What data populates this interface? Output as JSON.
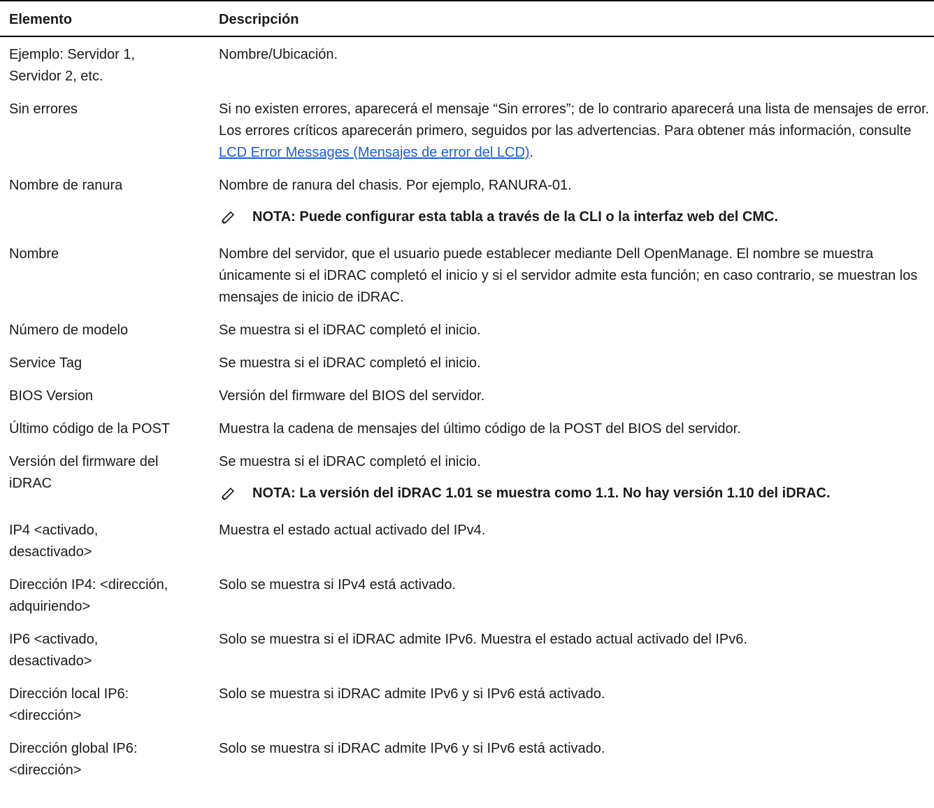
{
  "table": {
    "headers": [
      "Elemento",
      "Descripción"
    ],
    "rows": [
      {
        "item": "Ejemplo: Servidor 1,\nServidor 2, etc.",
        "desc": "Nombre/Ubicación."
      },
      {
        "item": "Sin errores",
        "desc_parts": [
          "Si no existen errores, aparecerá el mensaje “Sin errores”; de lo contrario aparecerá una lista de mensajes de error. Los errores críticos aparecerán primero, seguidos por las advertencias. Para obtener más información, consulte ",
          "LCD Error Messages (Mensajes de error del LCD)",
          "."
        ]
      },
      {
        "item": "Nombre de ranura",
        "desc": "Nombre de ranura del chasis. Por ejemplo, RANURA-01.",
        "note": "NOTA: Puede configurar esta tabla a través de la CLI o la interfaz web del CMC."
      },
      {
        "item": "Nombre",
        "desc": "Nombre del servidor, que el usuario puede establecer mediante Dell OpenManage. El nombre se muestra únicamente si el iDRAC completó el inicio y si el servidor admite esta función; en caso contrario, se muestran los mensajes de inicio de iDRAC."
      },
      {
        "item": "Número de modelo",
        "desc": "Se muestra si el iDRAC completó el inicio."
      },
      {
        "item": "Service Tag",
        "desc": "Se muestra si el iDRAC completó el inicio."
      },
      {
        "item": "BIOS Version",
        "desc": "Versión del firmware del BIOS del servidor."
      },
      {
        "item": "Último código de la POST",
        "desc": "Muestra la cadena de mensajes del último código de la POST del BIOS del servidor."
      },
      {
        "item": "Versión del firmware del\niDRAC",
        "desc": "Se muestra si el iDRAC completó el inicio.",
        "note": "NOTA: La versión del iDRAC 1.01 se muestra como 1.1. No hay versión 1.10 del iDRAC."
      },
      {
        "item": "IP4 <activado,\ndesactivado>",
        "desc": "Muestra el estado actual activado del IPv4."
      },
      {
        "item": "Dirección IP4: <dirección,\nadquiriendo>",
        "desc": "Solo se muestra si IPv4 está activado."
      },
      {
        "item": "IP6 <activado,\ndesactivado>",
        "desc": "Solo se muestra si el iDRAC admite IPv6. Muestra el estado actual activado del IPv6."
      },
      {
        "item": "Dirección local IP6:\n<dirección>",
        "desc": "Solo se muestra si iDRAC admite IPv6 y si IPv6 está activado."
      },
      {
        "item": "Dirección global IP6:\n<dirección>",
        "desc": "Solo se muestra si iDRAC admite IPv6 y si IPv6 está activado."
      }
    ]
  },
  "icons": {
    "note": "pencil-icon"
  },
  "colors": {
    "link": "#1a5fd1"
  }
}
